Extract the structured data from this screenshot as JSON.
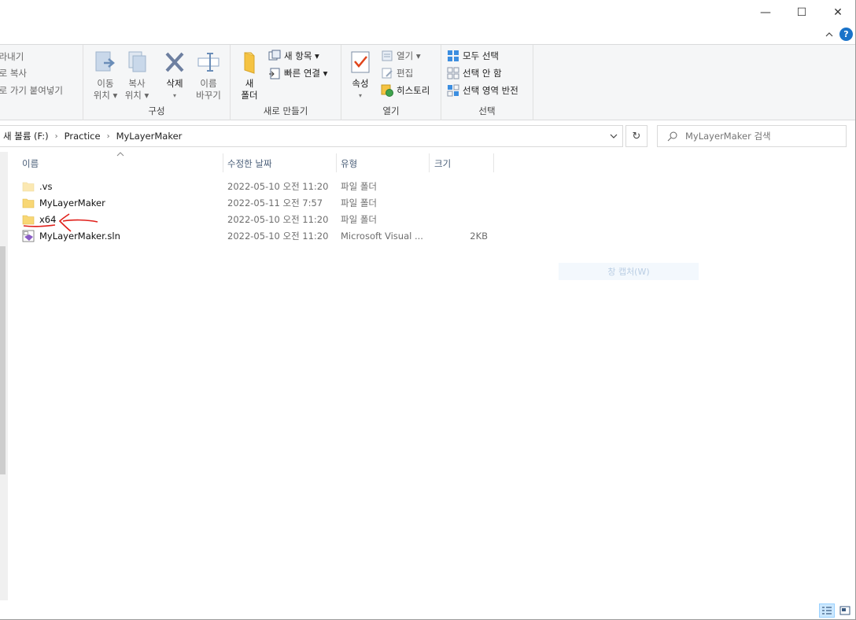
{
  "window": {
    "min_glyph": "—",
    "max_glyph": "☐",
    "close_glyph": "✕",
    "help_glyph": "?"
  },
  "ribbon": {
    "clipboard": {
      "cut_label": "잘라내기",
      "copy_path_label": "경로 복사",
      "paste_shortcut_label": "바로 가기 붙여넣기"
    },
    "organize": {
      "label": "구성",
      "move_to": [
        "이동",
        "위치 ▾"
      ],
      "copy_to": [
        "복사",
        "위치 ▾"
      ],
      "delete": "삭제",
      "delete_arrow": "▾",
      "rename": [
        "이름",
        "바꾸기"
      ]
    },
    "new": {
      "label": "새로 만들기",
      "new_folder": [
        "새",
        "폴더"
      ],
      "new_item": "새 항목 ▾",
      "easy_access": "빠른 연결 ▾"
    },
    "open": {
      "label": "열기",
      "properties": "속성",
      "properties_arrow": "▾",
      "open_item": "열기 ▾",
      "edit": "편집",
      "history": "히스토리"
    },
    "select": {
      "label": "선택",
      "select_all": "모두 선택",
      "select_none": "선택 안 함",
      "invert": "선택 영역 반전"
    }
  },
  "address": {
    "crumbs": [
      "새 볼륨 (F:)",
      "Practice",
      "MyLayerMaker"
    ],
    "dropdown_glyph": "⌄",
    "refresh_glyph": "↻",
    "search_placeholder": "MyLayerMaker 검색"
  },
  "columns": {
    "name": "이름",
    "date": "수정한 날짜",
    "type": "유형",
    "size": "크기"
  },
  "files": [
    {
      "name": ".vs",
      "date": "2022-05-10 오전 11:20",
      "type": "파일 폴더",
      "size": "",
      "kind": "folder"
    },
    {
      "name": "MyLayerMaker",
      "date": "2022-05-11 오전 7:57",
      "type": "파일 폴더",
      "size": "",
      "kind": "folder"
    },
    {
      "name": "x64",
      "date": "2022-05-10 오전 11:20",
      "type": "파일 폴더",
      "size": "",
      "kind": "folder"
    },
    {
      "name": "MyLayerMaker.sln",
      "date": "2022-05-10 오전 11:20",
      "type": "Microsoft Visual ...",
      "size": "2KB",
      "kind": "sln"
    }
  ],
  "ghost_label": "창 캡처(W)",
  "colors": {
    "accent": "#1a73c9",
    "folder": "#f8d775",
    "annotation": "#e0201b"
  }
}
